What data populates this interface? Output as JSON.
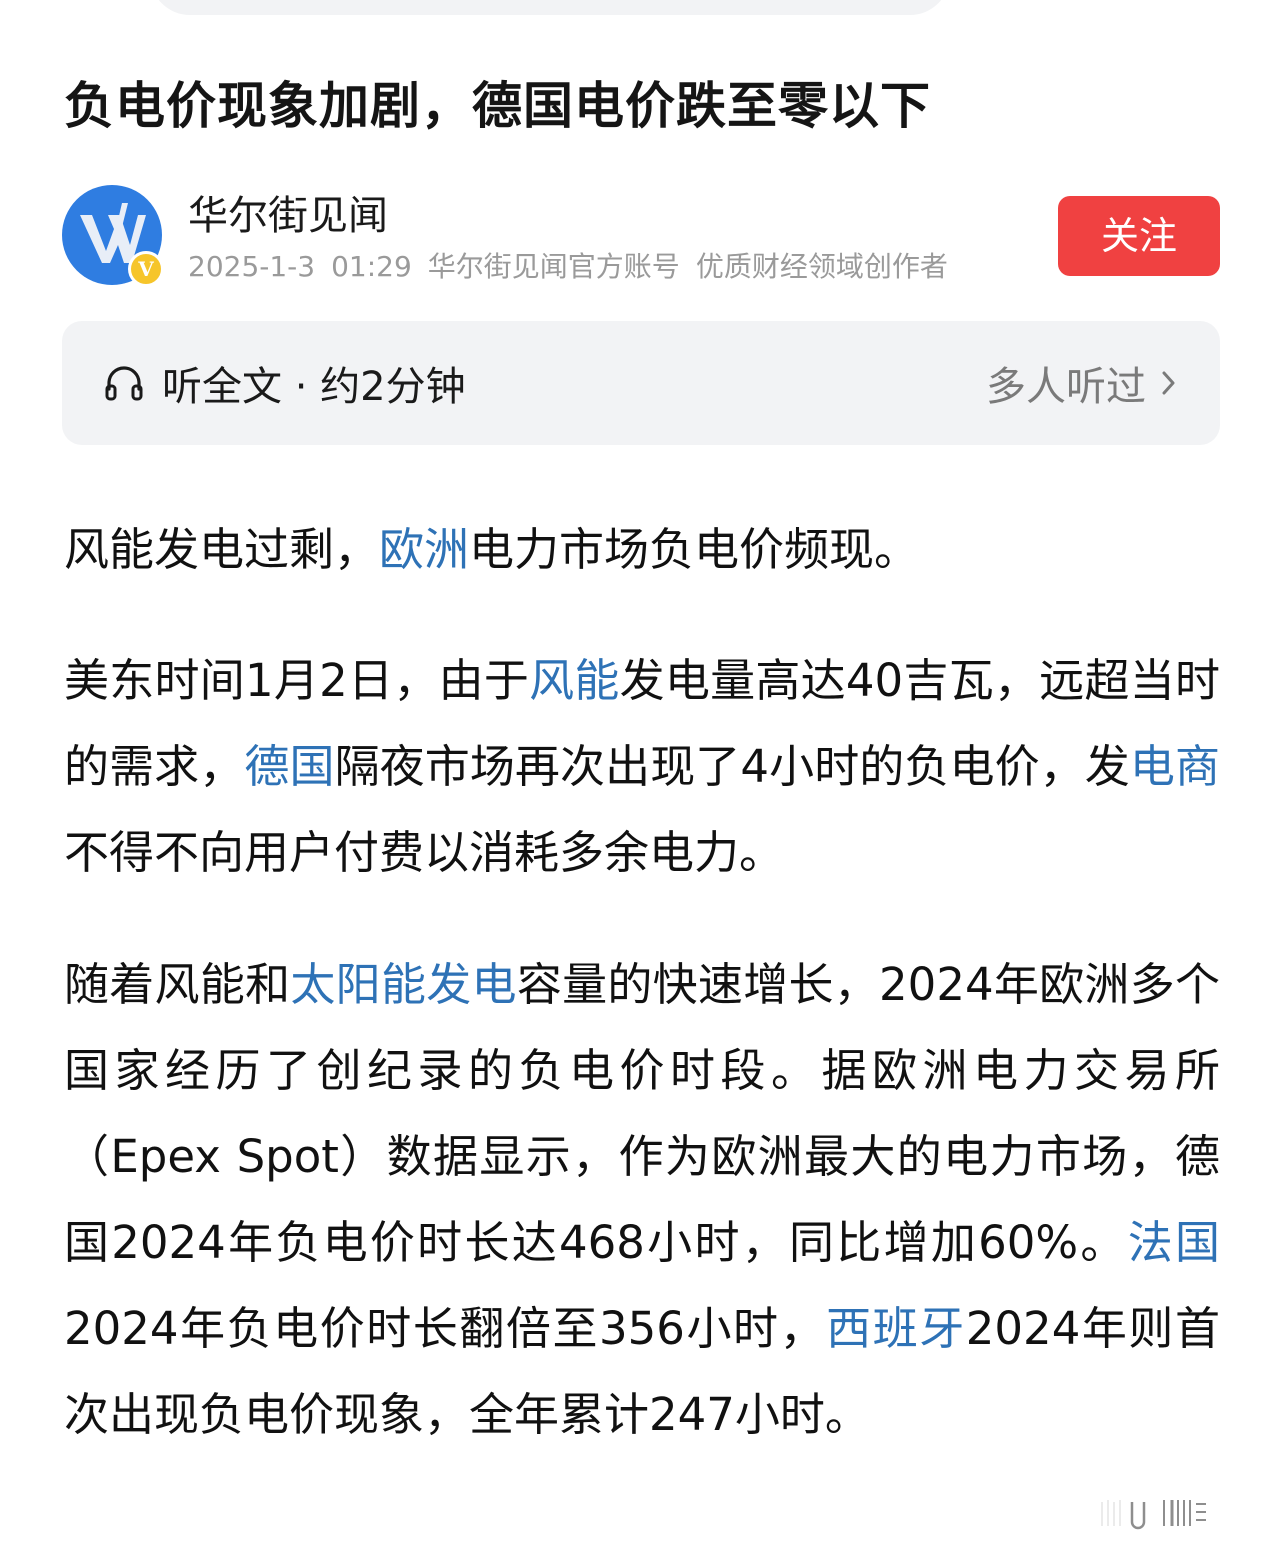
{
  "article": {
    "title": "负电价现象加剧，德国电价跌至零以下"
  },
  "author": {
    "name": "华尔街见闻",
    "date": "2025-1-3",
    "time": "01:29",
    "account_type": "华尔街见闻官方账号",
    "creator_tag": "优质财经领域创作者",
    "avatar_icon": "wallstreetcn-logo-icon",
    "verified_badge": "V",
    "follow_label": "关注",
    "colors": {
      "avatar_bg": "#2f7de1",
      "badge": "#f6c52b",
      "follow_button": "#f04141"
    }
  },
  "listen": {
    "icon": "headphone-icon",
    "label": "听全文 · 约2分钟",
    "right_label": "多人听过",
    "right_icon": "chevron-right-icon"
  },
  "link_color": "#2e72b6",
  "body": {
    "p1": {
      "t0": "风能发电过剩，",
      "l0": "欧洲",
      "t1": "电力市场负电价频现。"
    },
    "p2": {
      "t0": "美东时间1月2日，由于",
      "l0": "风能",
      "t1": "发电量高达40吉瓦，远超当时的需求，",
      "l1": "德国",
      "t2": "隔夜市场再次出现了4小时的负电价，发",
      "l2": "电商",
      "t3": "不得不向用户付费以消耗多余电力。"
    },
    "p3": {
      "t0": "随着风能和",
      "l0": "太阳能发电",
      "t1": "容量的快速增长，2024年欧洲多个国家经历了创纪录的负电价时段。据欧洲电力交易所（Epex Spot）数据显示，作为欧洲最大的电力市场，德国2024年负电价时长达468小时，同比增加60%。",
      "l1": "法国",
      "t2": "2024年负电价时长翻倍至356小时，",
      "l2": "西班牙",
      "t3": "2024年则首次出现负电价现象，全年累计247小时。"
    }
  },
  "watermark": {
    "icon": "watermark-logo-icon"
  }
}
